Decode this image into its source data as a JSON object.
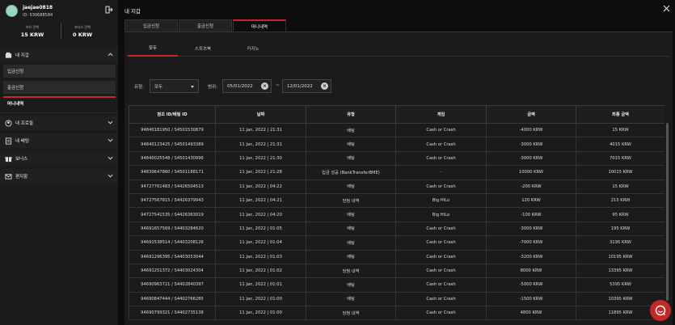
{
  "user": {
    "username": "jaejae0818",
    "id_label": "ID: 530688584",
    "balances": [
      {
        "label": "보유 잔액",
        "value": "15 KRW"
      },
      {
        "label": "보너스 잔액",
        "value": "0 KRW"
      }
    ]
  },
  "sidebar": {
    "wallet": {
      "label": "내 지갑",
      "icon": "wallet-icon"
    },
    "wallet_items": [
      "입금신청",
      "출금신청",
      "머니내역"
    ],
    "sections": [
      {
        "label": "내 프로필",
        "icon": "profile-icon"
      },
      {
        "label": "내 베팅",
        "icon": "bet-icon"
      },
      {
        "label": "보너스",
        "icon": "gift-icon"
      },
      {
        "label": "편지함",
        "icon": "mail-icon"
      }
    ]
  },
  "main": {
    "title": "내 지갑",
    "tabs": [
      "입금신청",
      "출금신청",
      "머니내역"
    ],
    "subtabs": [
      "모두",
      "스포츠북",
      "카지노"
    ],
    "filter": {
      "type_label": "유형:",
      "type_value": "모두",
      "range_label": "범위:",
      "date_from": "05/01/2022",
      "date_to": "12/01/2022",
      "range_sep": "~"
    },
    "table": {
      "headers": [
        "참조 ID/베팅 ID",
        "날짜",
        "유형",
        "게임",
        "금액",
        "최종 금액"
      ],
      "rows": [
        [
          "94840181950 / S4501530879",
          "11 Jan, 2022 | 21:31",
          "배팅",
          "Cash or Crash",
          "-4000 KRW",
          "15 KRW"
        ],
        [
          "94840123425 / S4501493389",
          "11 Jan, 2022 | 21:31",
          "배팅",
          "Cash or Crash",
          "-3000 KRW",
          "4015 KRW"
        ],
        [
          "94840025548 / S4501430996",
          "11 Jan, 2022 | 21:30",
          "배팅",
          "Cash or Crash",
          "-3000 KRW",
          "7015 KRW"
        ],
        [
          "94839647860 / S4501188171",
          "11 Jan, 2022 | 21:28",
          "입금 성공 (BankTransferBME)",
          "-",
          "10000 KRW",
          "10015 KRW"
        ],
        [
          "94727761483 / S4426504513",
          "11 Jan, 2022 | 04:22",
          "배팅",
          "Cash or Crash",
          "-200 KRW",
          "15 KRW"
        ],
        [
          "94727567815 / S4426379943",
          "11 Jan, 2022 | 04:21",
          "당첨 내역",
          "Big HiLo",
          "120 KRW",
          "215 KRW"
        ],
        [
          "94727541535 / S4426363019",
          "11 Jan, 2022 | 04:20",
          "배팅",
          "Big HiLo",
          "-100 KRW",
          "95 KRW"
        ],
        [
          "94691657569 / S4403284620",
          "11 Jan, 2022 | 01:05",
          "배팅",
          "Cash or Crash",
          "-3000 KRW",
          "195 KRW"
        ],
        [
          "94691538514 / S4403208126",
          "11 Jan, 2022 | 01:04",
          "배팅",
          "Cash or Crash",
          "-7000 KRW",
          "3195 KRW"
        ],
        [
          "94691296395 / S4403053044",
          "11 Jan, 2022 | 01:03",
          "배팅",
          "Cash or Crash",
          "-3200 KRW",
          "10195 KRW"
        ],
        [
          "94691251372 / S4403024304",
          "11 Jan, 2022 | 01:02",
          "당첨 내역",
          "Cash or Crash",
          "8000 KRW",
          "13395 KRW"
        ],
        [
          "94690963721 / S4402840397",
          "11 Jan, 2022 | 01:01",
          "배팅",
          "Cash or Crash",
          "-5000 KRW",
          "5395 KRW"
        ],
        [
          "94690847444 / S4402766285",
          "11 Jan, 2022 | 01:00",
          "배팅",
          "Cash or Crash",
          "-1500 KRW",
          "10395 KRW"
        ],
        [
          "94690799321 / S4402735138",
          "11 Jan, 2022 | 01:00",
          "당첨 내역",
          "Cash or Crash",
          "4800 KRW",
          "11895 KRW"
        ]
      ]
    }
  },
  "colors": {
    "accent": "#c62828",
    "sidebar_bg": "#1b1b1b",
    "page_bg": "#0d0d0d"
  }
}
